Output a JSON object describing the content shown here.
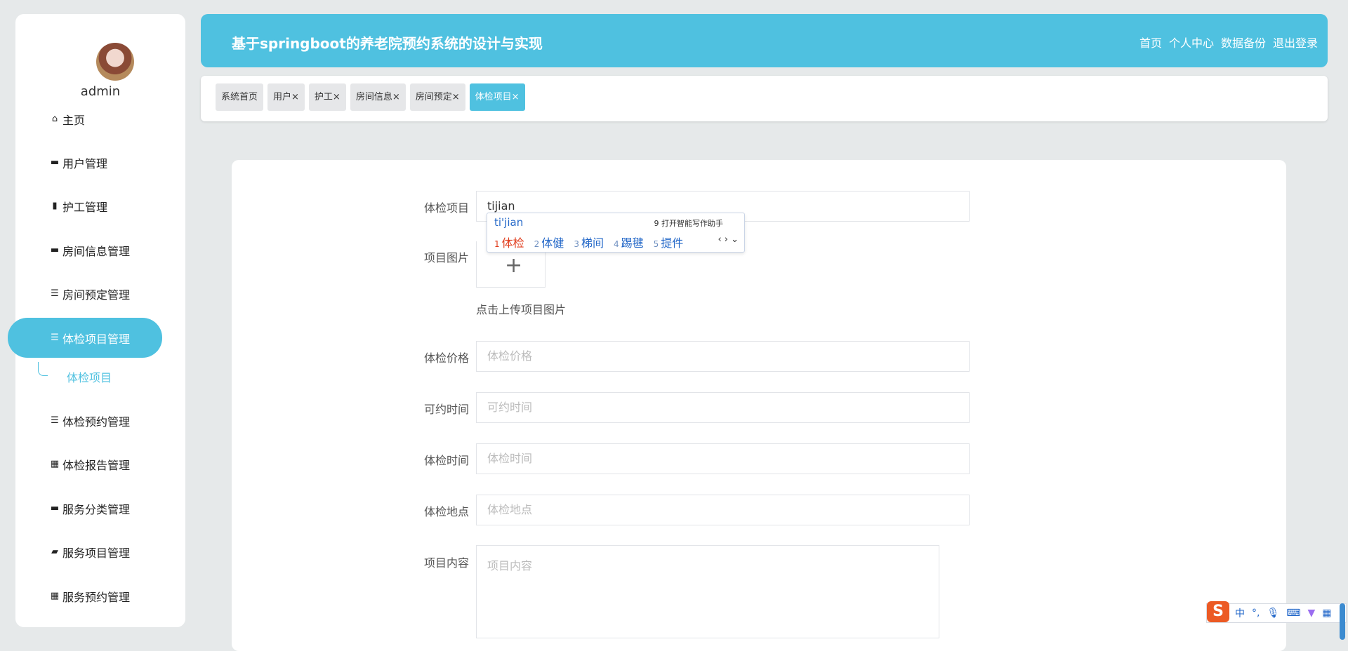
{
  "sidebar": {
    "username": "admin",
    "items": [
      {
        "label": "主页",
        "icon": "home-icon"
      },
      {
        "label": "用户管理",
        "icon": "briefcase-icon"
      },
      {
        "label": "护工管理",
        "icon": "clipboard-icon"
      },
      {
        "label": "房间信息管理",
        "icon": "inbox-icon"
      },
      {
        "label": "房间预定管理",
        "icon": "sliders-icon"
      },
      {
        "label": "体检项目管理",
        "icon": "list-icon",
        "active": true
      },
      {
        "label": "体检预约管理",
        "icon": "list-icon"
      },
      {
        "label": "体检报告管理",
        "icon": "grid-icon"
      },
      {
        "label": "服务分类管理",
        "icon": "monitor-icon"
      },
      {
        "label": "服务项目管理",
        "icon": "wallet-icon"
      },
      {
        "label": "服务预约管理",
        "icon": "grid-icon"
      }
    ],
    "subitem": "体检项目"
  },
  "header": {
    "title": "基于springboot的养老院预约系统的设计与实现",
    "nav": [
      "首页",
      "个人中心",
      "数据备份",
      "退出登录"
    ]
  },
  "tabs": [
    "系统首页",
    "用户×",
    "护工×",
    "房间信息×",
    "房间预定×",
    "体检项目×"
  ],
  "form": {
    "name_label": "体检项目",
    "name_value": "tijian",
    "image_label": "项目图片",
    "upload_hint": "点击上传项目图片",
    "price_label": "体检价格",
    "price_placeholder": "体检价格",
    "time_label": "可约时间",
    "time_placeholder": "可约时间",
    "exam_time_label": "体检时间",
    "exam_time_placeholder": "体检时间",
    "place_label": "体检地点",
    "place_placeholder": "体检地点",
    "content_label": "项目内容",
    "content_placeholder": "项目内容"
  },
  "ime": {
    "pinyin": "ti'jian",
    "helper": "9 打开智能写作助手",
    "candidates": [
      {
        "n": "1",
        "w": "体检"
      },
      {
        "n": "2",
        "w": "体健"
      },
      {
        "n": "3",
        "w": "梯间"
      },
      {
        "n": "4",
        "w": "踢毽"
      },
      {
        "n": "5",
        "w": "提件"
      }
    ],
    "toolbar": {
      "lang": "中",
      "punct": "°,"
    }
  }
}
